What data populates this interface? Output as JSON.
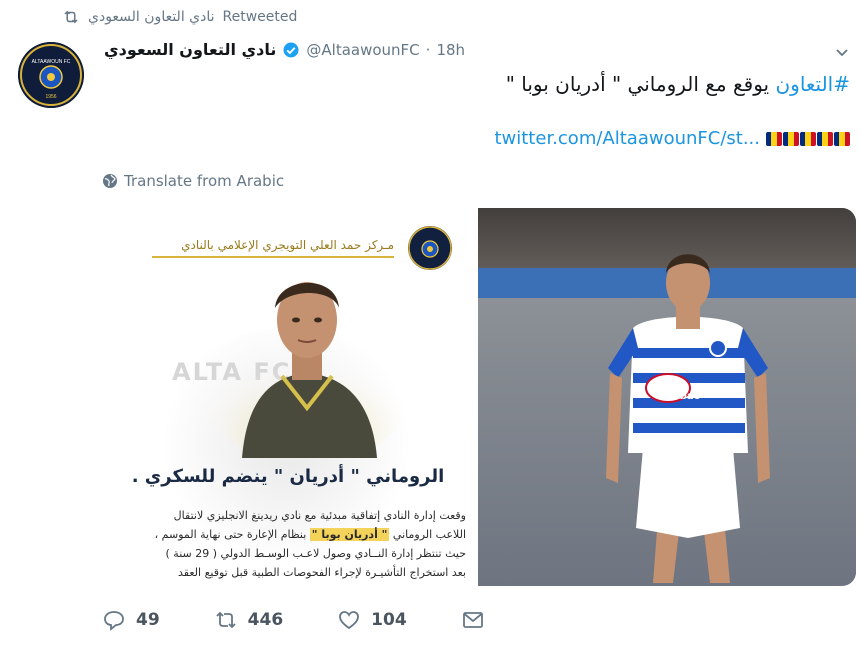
{
  "retweet": {
    "label": "Retweeted",
    "user": "نادي التعاون السعودي"
  },
  "tweet": {
    "display_name": "نادي التعاون السعودي",
    "handle": "@AltaawounFC",
    "time": "18h",
    "hashtag": "#التعاون",
    "text": "يوقع مع الروماني \" أدريان بوبا \"",
    "link": "twitter.com/AltaawounFC/st...",
    "translate": "Translate from Arabic"
  },
  "avatar": {
    "badge_text": "ALTAAWOUN FC",
    "year": "1956"
  },
  "poster": {
    "credit": "مـركز حمد العلي التويجري الإعلامي بالنادي",
    "ghost_text": "ALTA          FC",
    "title": "الروماني \" أدريان \" ينضم للسكري .",
    "body_1a": "وقعت إدارة النادي إتفاقية مبدئية مع نادي ريدينغ الانجليزي لانتقال",
    "body_2a": "اللاعب الروماني ",
    "body_2_highlight": "\" أدريان بوبا \"",
    "body_2b": " بنظام الإعارة حتى نهاية الموسم ،",
    "body_3": "حيث تنتظر إدارة النــادي وصول لاعـب الوسـط الدولي ( 29 سنة )",
    "body_4": "بعد استخراج التأشيـرة لإجراء الفحوصات الطبية قبل توقيع العقد"
  },
  "photo": {
    "sponsor": "Carabao"
  },
  "actions": {
    "replies": "49",
    "retweets": "446",
    "likes": "104"
  },
  "colors": {
    "link": "#1b95e0",
    "muted": "#657786",
    "verified": "#1da1f2"
  }
}
